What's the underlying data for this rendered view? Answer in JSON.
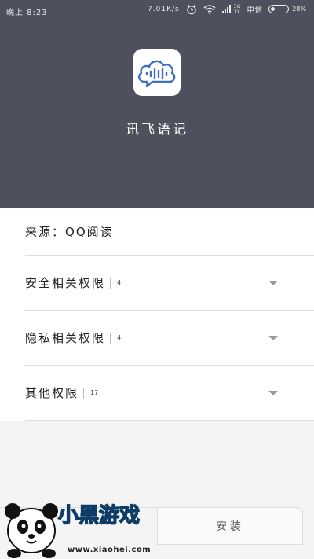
{
  "status_bar": {
    "time": "晚上 8:23",
    "net_speed": "7.01K/s",
    "signal_top": "3G",
    "signal_bottom": "1X",
    "carrier": "电信",
    "battery_percent": "28%",
    "battery_level": 0.28
  },
  "app": {
    "name": "讯飞语记",
    "icon": "cloud-soundwave-icon",
    "icon_color": "#3f6fbf"
  },
  "source": {
    "label": "来源：",
    "value": "QQ阅读"
  },
  "permissions": [
    {
      "label": "安全相关权限",
      "count": "4"
    },
    {
      "label": "隐私相关权限",
      "count": "4"
    },
    {
      "label": "其他权限",
      "count": "17"
    }
  ],
  "actions": {
    "install_label": "安装"
  },
  "watermark": {
    "text": "小黑游戏",
    "url": "www.xiaohei.com"
  },
  "colors": {
    "header_bg": "#4e515d",
    "list_bg": "#ffffff",
    "page_bg": "#f4f4f4"
  }
}
